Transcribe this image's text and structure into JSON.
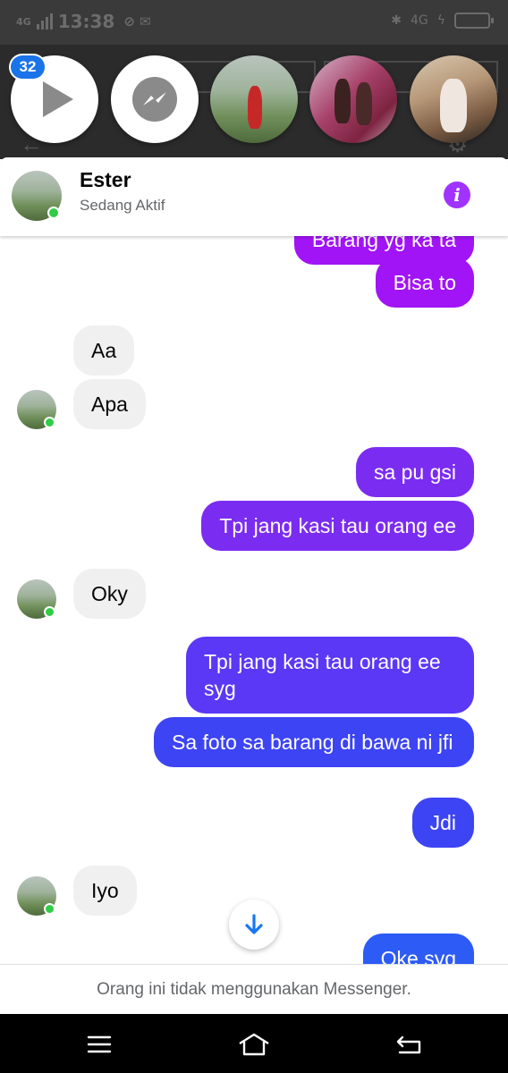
{
  "status_bar": {
    "network": "4G",
    "time": "13:38",
    "status_icons": "⊘ ✉",
    "right_network": "4G"
  },
  "chat_heads": {
    "badge_count": "32",
    "items": [
      "play-head",
      "messenger-head",
      "contact-head-1",
      "contact-head-2",
      "contact-head-3"
    ]
  },
  "header": {
    "name": "Ester",
    "status": "Sedang Aktif",
    "info_icon": "info-icon",
    "accent_color": "#a033ff"
  },
  "messages": [
    {
      "side": "sent",
      "text": "Barang yg ka ta"
    },
    {
      "side": "sent",
      "text": "Bisa to"
    },
    {
      "side": "recv",
      "text": "Aa"
    },
    {
      "side": "recv",
      "text": "Apa"
    },
    {
      "side": "sent",
      "text": "sa pu gsi"
    },
    {
      "side": "sent",
      "text": "Tpi jang kasi tau orang ee"
    },
    {
      "side": "recv",
      "text": "Oky"
    },
    {
      "side": "sent",
      "text": "Tpi jang kasi tau orang ee syg"
    },
    {
      "side": "sent",
      "text": "Sa foto sa barang di bawa ni jfi"
    },
    {
      "side": "sent",
      "text": "Jdi"
    },
    {
      "side": "recv",
      "text": "Iyo"
    },
    {
      "side": "sent",
      "text": "Oke syg"
    }
  ],
  "footer": {
    "notice": "Orang ini tidak menggunakan Messenger."
  },
  "colors": {
    "bubble_purple": "#a114f5",
    "bubble_violet": "#7b2cf1",
    "bubble_blue": "#3d44f4",
    "received_bg": "#f0f0f0",
    "online_dot": "#31cc46"
  }
}
